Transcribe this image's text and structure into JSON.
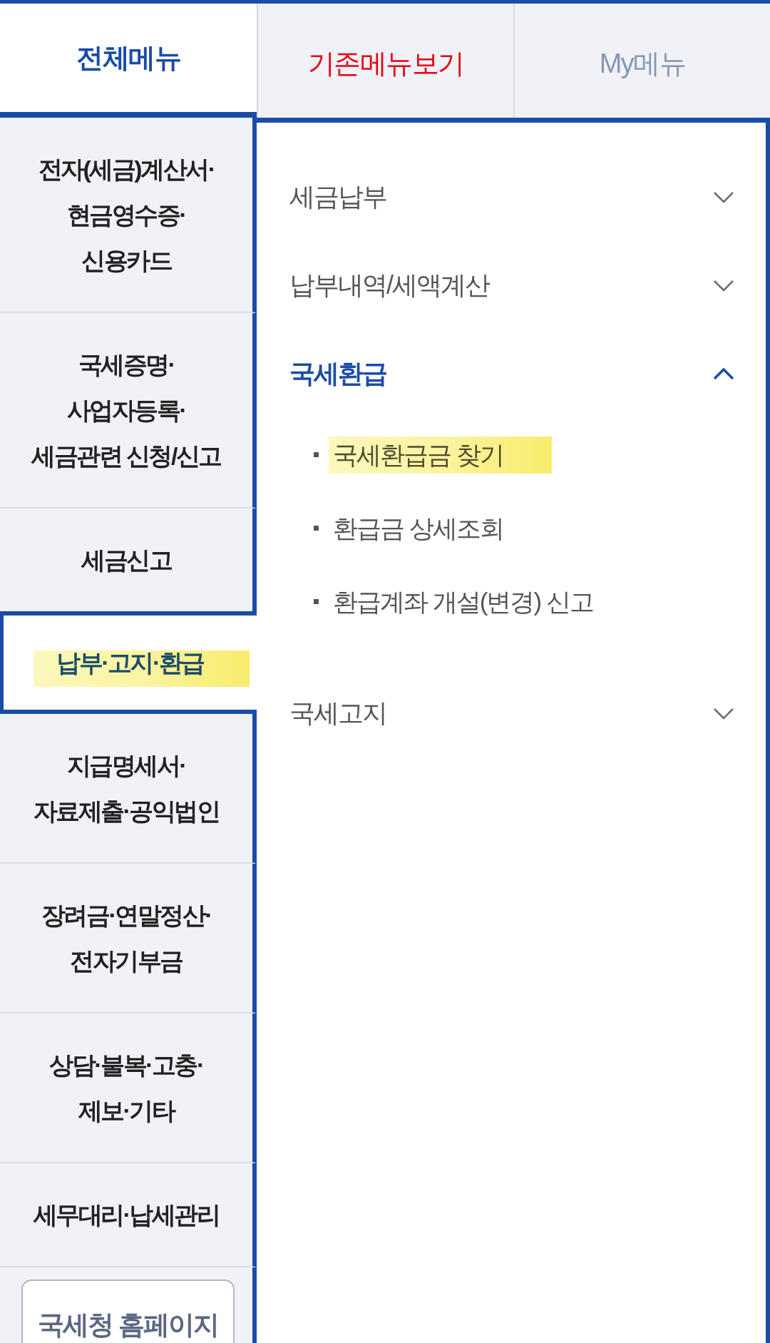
{
  "tabs": [
    {
      "label": "전체메뉴",
      "selected": true,
      "color": "#1a4ca8"
    },
    {
      "label": "기존메뉴보기",
      "selected": false,
      "color": "#e60012"
    },
    {
      "label": "My메뉴",
      "selected": false,
      "color": "#8797b3"
    }
  ],
  "sidebar": {
    "items": [
      {
        "label": "전자(세금)계산서·\n현금영수증·\n신용카드",
        "selected": false,
        "highlighted": false
      },
      {
        "label": "국세증명·\n사업자등록·\n세금관련 신청/신고",
        "selected": false,
        "highlighted": false
      },
      {
        "label": "세금신고",
        "selected": false,
        "highlighted": false
      },
      {
        "label": "납부·고지·환급",
        "selected": true,
        "highlighted": true
      },
      {
        "label": "지급명세서·\n자료제출·공익법인",
        "selected": false,
        "highlighted": false
      },
      {
        "label": "장려금·연말정산·\n전자기부금",
        "selected": false,
        "highlighted": false
      },
      {
        "label": "상담·불복·고충·\n제보·기타",
        "selected": false,
        "highlighted": false
      },
      {
        "label": "세무대리·납세관리",
        "selected": false,
        "highlighted": false
      }
    ],
    "home_button": {
      "label": "국세청 홈페이지"
    }
  },
  "submenu": {
    "items": [
      {
        "label": "세금납부",
        "expanded": false
      },
      {
        "label": "납부내역/세액계산",
        "expanded": false
      },
      {
        "label": "국세환급",
        "expanded": true,
        "children": [
          {
            "label": "국세환급금 찾기",
            "highlighted": true
          },
          {
            "label": "환급금 상세조회",
            "highlighted": false
          },
          {
            "label": "환급계좌 개설(변경) 신고",
            "highlighted": false
          }
        ]
      },
      {
        "label": "국세고지",
        "expanded": false
      }
    ]
  }
}
